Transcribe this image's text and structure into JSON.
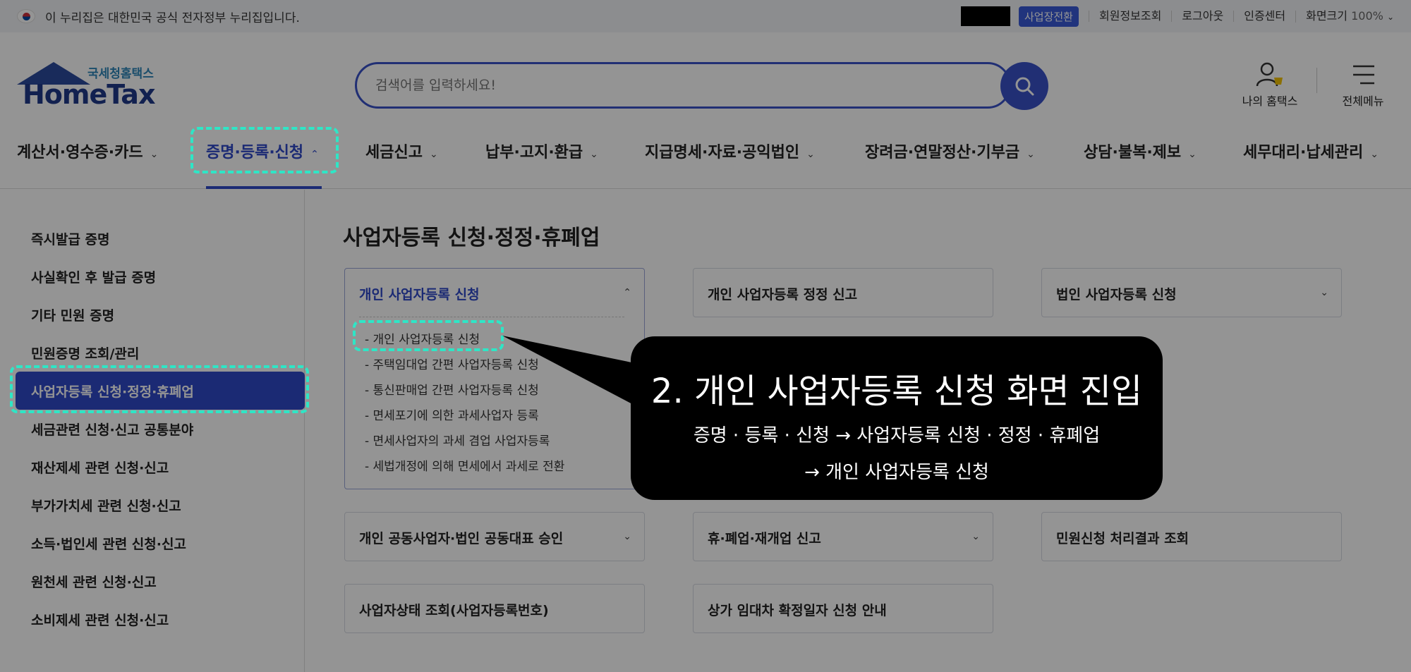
{
  "gov_bar": {
    "notice": "이 누리집은 대한민국 공식 전자정부 누리집입니다.",
    "switch_label": "사업장전환",
    "links": [
      "회원정보조회",
      "로그아웃",
      "인증센터"
    ],
    "zoom_label": "화면크기",
    "zoom_value": "100%"
  },
  "header": {
    "logo_sub": "국세청홈택스",
    "logo_main": "HomeTax",
    "search_placeholder": "검색어를 입력하세요!",
    "my_label": "나의 홈택스",
    "menu_label": "전체메뉴"
  },
  "nav": {
    "items": [
      "계산서·영수증·카드",
      "증명·등록·신청",
      "세금신고",
      "납부·고지·환급",
      "지급명세·자료·공익법인",
      "장려금·연말정산·기부금",
      "상담·불복·제보",
      "세무대리·납세관리"
    ],
    "active_index": 1
  },
  "sidebar": {
    "items": [
      "즉시발급 증명",
      "사실확인 후 발급 증명",
      "기타 민원 증명",
      "민원증명 조회/관리",
      "사업자등록 신청·정정·휴폐업",
      "세금관련 신청·신고 공통분야",
      "재산제세 관련 신청·신고",
      "부가가치세 관련 신청·신고",
      "소득·법인세 관련 신청·신고",
      "원천세 관련 신청·신고",
      "소비제세 관련 신청·신고"
    ],
    "active_index": 4
  },
  "content": {
    "title": "사업자등록 신청·정정·휴폐업",
    "open_card": {
      "label": "개인 사업자등록 신청",
      "sub_items": [
        "개인 사업자등록 신청",
        "주택임대업 간편 사업자등록 신청",
        "통신판매업 간편 사업자등록 신청",
        "면세포기에 의한 과세사업자 등록",
        "면세사업자의 과세 겸업 사업자등록",
        "세법개정에 의해 면세에서 과세로 전환"
      ]
    },
    "cards": [
      "개인 사업자등록 정정 신고",
      "법인 사업자등록 신청",
      "개인 공동사업자·법인 공동대표 승인",
      "휴·폐업·재개업 신고",
      "민원신청 처리결과 조회",
      "사업자상태 조회(사업자등록번호)",
      "상가 임대차 확정일자 신청 안내"
    ]
  },
  "callout": {
    "title": "2. 개인 사업자등록 신청 화면 진입",
    "line1": "증명 · 등록 · 신청 → 사업자등록 신청 · 정정 · 휴폐업",
    "line2": "→ 개인 사업자등록 신청"
  },
  "colors": {
    "brand_blue": "#2f49c9",
    "highlight": "#2ee6c6",
    "callout_bg": "#000000"
  }
}
